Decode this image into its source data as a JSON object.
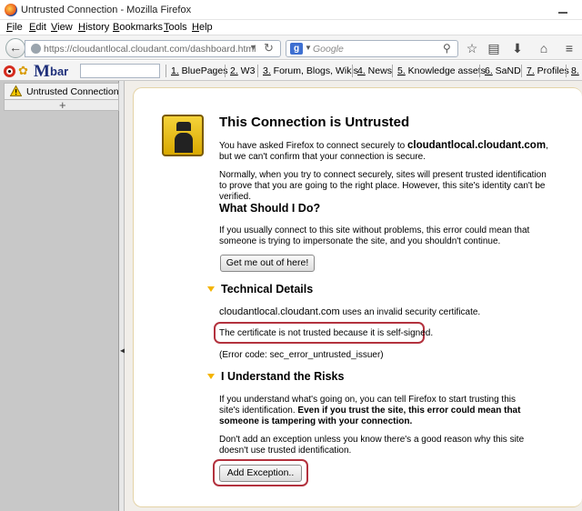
{
  "window": {
    "title": "Untrusted Connection - Mozilla Firefox"
  },
  "menu": [
    "File",
    "Edit",
    "View",
    "History",
    "Bookmarks",
    "Tools",
    "Help"
  ],
  "nav": {
    "url": "https://cloudantlocal.cloudant.com/dashboard.html",
    "search_placeholder": "Google",
    "search_engine_letter": "g"
  },
  "toolbar_logo": {
    "letter": "M",
    "text": "bar"
  },
  "bookmarks": [
    {
      "num": "1.",
      "label": " BluePages"
    },
    {
      "num": "2.",
      "label": " W3"
    },
    {
      "num": "3.",
      "label": " Forum, Blogs, Wikis"
    },
    {
      "num": "4.",
      "label": " News"
    },
    {
      "num": "5.",
      "label": " Knowledge assets"
    },
    {
      "num": "6.",
      "label": " SaND"
    },
    {
      "num": "7.",
      "label": " Profiles"
    },
    {
      "num": "8.",
      "label": ""
    }
  ],
  "sidebar": {
    "tab_label": "Untrusted Connection",
    "add_symbol": "+"
  },
  "page": {
    "title": "This Connection is Untrusted",
    "intro_prefix": "You have asked Firefox to connect securely to ",
    "intro_host": "cloudantlocal.cloudant.com",
    "intro_suffix": ", but we can't confirm that your connection is secure.",
    "normally": "Normally, when you try to connect securely, sites will present trusted identification to prove that you are going to the right place. However, this site's identity can't be verified.",
    "what_heading": "What Should I Do?",
    "what_text": "If you usually connect to this site without problems, this error could mean that someone is trying to impersonate the site, and you shouldn't continue.",
    "get_out_button": "Get me out of here!",
    "tech_heading": "Technical Details",
    "tech_host": "cloudantlocal.cloudant.com",
    "tech_text": " uses an invalid security certificate.",
    "tech_reason": "The certificate is not trusted because it is self-signed.",
    "error_code": "(Error code: sec_error_untrusted_issuer)",
    "risks_heading": "I Understand the Risks",
    "risks_text1": "If you understand what's going on, you can tell Firefox to start trusting this site's identification. ",
    "risks_text1_bold": "Even if you trust the site, this error could mean that someone is tampering with your connection.",
    "risks_text2": "Don't add an exception unless you know there's a good reason why this site doesn't use trusted identification.",
    "add_exception_button": "Add Exception.."
  }
}
